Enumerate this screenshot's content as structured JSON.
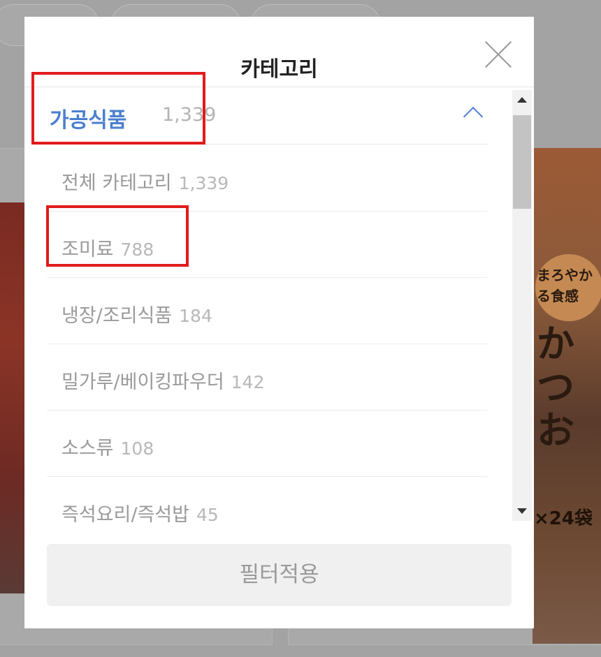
{
  "modal": {
    "title": "카테고리",
    "category": {
      "name": "가공식품",
      "count": "1,339"
    },
    "items": [
      {
        "label": "전체 카테고리",
        "count": "1,339"
      },
      {
        "label": "조미료",
        "count": "788"
      },
      {
        "label": "냉장/조리식품",
        "count": "184"
      },
      {
        "label": "밀가루/베이킹파우더",
        "count": "142"
      },
      {
        "label": "소스류",
        "count": "108"
      },
      {
        "label": "즉석요리/즉석밥",
        "count": "45"
      }
    ],
    "apply_label": "필터적용"
  },
  "background": {
    "product_right": {
      "text1": "まろやか",
      "text2": "る食感",
      "text3": "かつお",
      "pack": "×24袋"
    }
  },
  "colors": {
    "accent": "#4a7fcf",
    "annotation": "#e11b1b",
    "muted_text": "#9a9a9a"
  },
  "icons": {
    "close": "close-icon",
    "collapse": "chevron-up-icon",
    "scroll_up": "scroll-up-arrow-icon",
    "scroll_down": "scroll-down-arrow-icon"
  }
}
